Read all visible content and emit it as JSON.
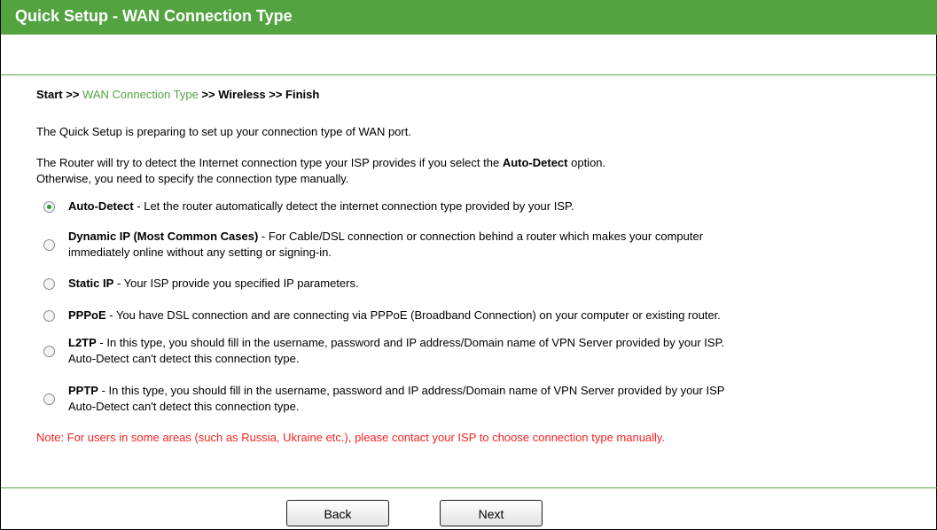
{
  "header": {
    "title": "Quick Setup - WAN Connection Type"
  },
  "breadcrumb": {
    "start": "Start",
    "sep1": " >> ",
    "current": "WAN Connection Type",
    "sep2": " >> ",
    "wireless": "Wireless",
    "sep3": " >> ",
    "finish": "Finish"
  },
  "intro": "The Quick Setup is preparing to set up your connection type of WAN port.",
  "detect_info": {
    "line1_prefix": "The Router will try to detect the Internet connection type your ISP provides if you select the ",
    "line1_bold": "Auto-Detect",
    "line1_suffix": " option.",
    "line2": "Otherwise, you need to specify the connection type manually."
  },
  "options": [
    {
      "name": "Auto-Detect",
      "desc": " - Let the router automatically detect the internet connection type provided by your ISP.",
      "desc2": "",
      "selected": true
    },
    {
      "name": "Dynamic IP (Most Common Cases)",
      "desc": " - For Cable/DSL connection or connection behind a router which makes your computer",
      "desc2": "immediately online without any setting or signing-in.",
      "selected": false
    },
    {
      "name": "Static IP",
      "desc": " - Your ISP provide you specified IP parameters.",
      "desc2": "",
      "selected": false
    },
    {
      "name": "PPPoE",
      "desc": " - You have DSL connection and are connecting via PPPoE (Broadband Connection) on your computer or existing router.",
      "desc2": "",
      "selected": false
    },
    {
      "name": "L2TP",
      "desc": " - In this type, you should fill in the username, password and IP address/Domain name of VPN Server provided by your ISP.",
      "desc2": "Auto-Detect can't detect this connection type.",
      "selected": false
    },
    {
      "name": "PPTP",
      "desc": " - In this type, you should fill in the username, password and IP address/Domain name of VPN Server provided by your ISP",
      "desc2": "Auto-Detect can't detect this connection type.",
      "selected": false
    }
  ],
  "note": "Note: For users in some areas (such as Russia, Ukraine etc.), please contact your ISP to choose connection type manually.",
  "buttons": {
    "back": "Back",
    "next": "Next"
  },
  "colors": {
    "accent": "#53a341",
    "note": "#ff2020"
  }
}
